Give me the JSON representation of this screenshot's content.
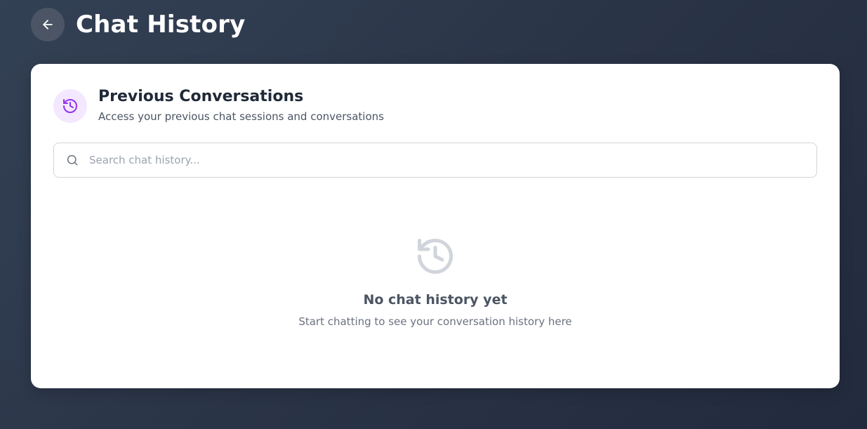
{
  "header": {
    "title": "Chat History",
    "back_icon": "arrow-left-icon"
  },
  "section": {
    "icon": "history-icon",
    "title": "Previous Conversations",
    "subtitle": "Access your previous chat sessions and conversations"
  },
  "search": {
    "icon": "search-icon",
    "placeholder": "Search chat history...",
    "value": ""
  },
  "empty_state": {
    "icon": "history-icon",
    "title": "No chat history yet",
    "subtitle": "Start chatting to see your conversation history here"
  },
  "colors": {
    "accent": "#9333ea",
    "accent_bg": "#f3e8ff",
    "empty_icon": "#d1d5db"
  }
}
